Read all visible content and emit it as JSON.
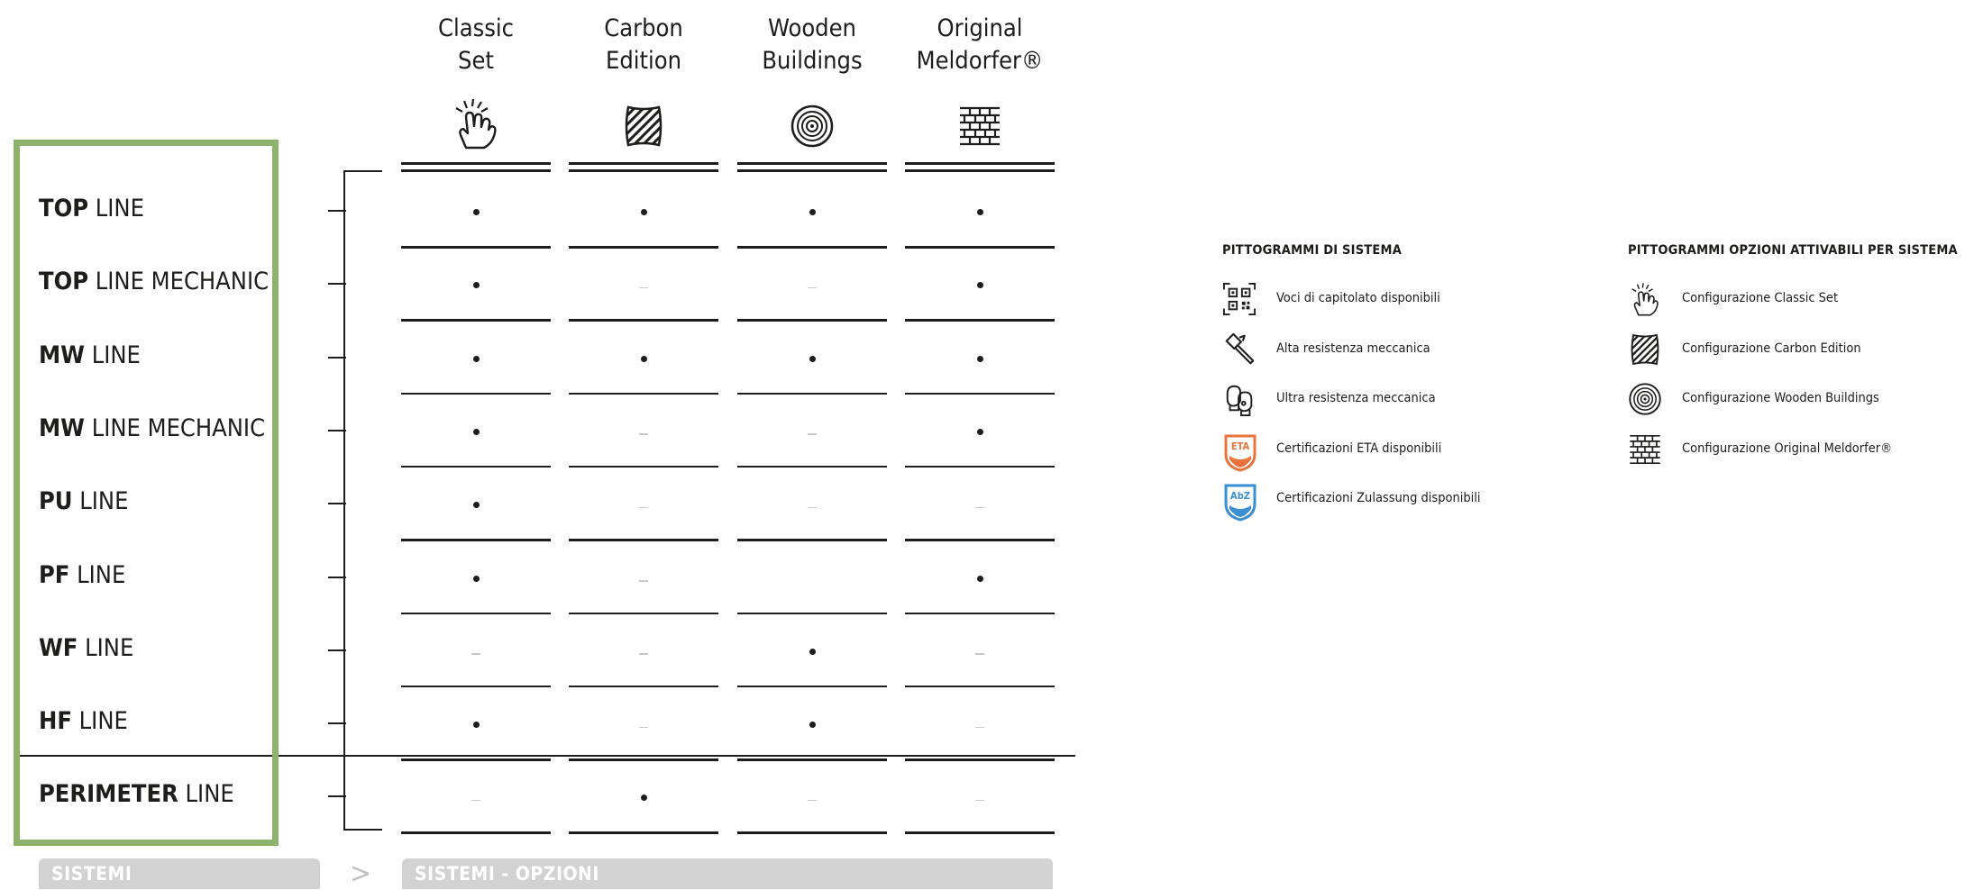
{
  "columns": [
    {
      "name": "Classic Set",
      "line1": "Classic",
      "line2": "Set",
      "icon": "hand-icon"
    },
    {
      "name": "Carbon Edition",
      "line1": "Carbon",
      "line2": "Edition",
      "icon": "carbon-stripes-icon"
    },
    {
      "name": "Wooden Buildings",
      "line1": "Wooden",
      "line2": "Buildings",
      "icon": "wood-rings-icon"
    },
    {
      "name": "Original Meldorfer",
      "line1": "Original",
      "line2": "Meldorfer®",
      "icon": "brick-wall-icon"
    }
  ],
  "rows": [
    {
      "bold": "TOP",
      "rest": " LINE",
      "values": [
        "dot",
        "dot",
        "dot",
        "dot"
      ]
    },
    {
      "bold": "TOP",
      "rest": " LINE MECHANIC",
      "values": [
        "dot",
        "dash",
        "dash",
        "dot"
      ]
    },
    {
      "bold": "MW",
      "rest": " LINE",
      "values": [
        "dot",
        "dot",
        "dot",
        "dot"
      ]
    },
    {
      "bold": "MW",
      "rest": " LINE MECHANIC",
      "values": [
        "dot",
        "dash",
        "dash",
        "dot"
      ]
    },
    {
      "bold": "PU",
      "rest": " LINE",
      "values": [
        "dot",
        "dash",
        "dash",
        "dash"
      ]
    },
    {
      "bold": "PF",
      "rest": " LINE",
      "values": [
        "dot",
        "dash",
        "",
        "dot"
      ]
    },
    {
      "bold": "WF",
      "rest": " LINE",
      "values": [
        "dash",
        "dash",
        "dot",
        "dash"
      ]
    },
    {
      "bold": "HF",
      "rest": " LINE",
      "values": [
        "dot",
        "dash",
        "dot",
        "dash"
      ]
    },
    {
      "bold": "PERIMETER",
      "rest": " LINE",
      "values": [
        "dash",
        "dot",
        "dash",
        "dash"
      ]
    }
  ],
  "footer": {
    "left": "SISTEMI",
    "arrow": ">",
    "right": "SISTEMI - OPZIONI"
  },
  "legend_system": {
    "title": "PITTOGRAMMI DI SISTEMA",
    "items": [
      {
        "icon": "qr-code-icon",
        "text": "Voci di capitolato disponibili"
      },
      {
        "icon": "hammer-icon",
        "text": "Alta resistenza meccanica"
      },
      {
        "icon": "boxing-gloves-icon",
        "text": "Ultra resistenza meccanica"
      },
      {
        "icon": "eta-badge-icon",
        "text": "Certificazioni ETA disponibili",
        "badge": "ETA",
        "color": "#e8743b"
      },
      {
        "icon": "abz-badge-icon",
        "text": "Certificazioni Zulassung disponibili",
        "badge": "AbZ",
        "color": "#3b8fd0"
      }
    ]
  },
  "legend_options": {
    "title": "PITTOGRAMMI OPZIONI ATTIVABILI PER SISTEMA",
    "items": [
      {
        "icon": "hand-icon",
        "text": "Configurazione Classic Set"
      },
      {
        "icon": "carbon-stripes-icon",
        "text": "Configurazione Carbon Edition"
      },
      {
        "icon": "wood-rings-icon",
        "text": "Configurazione Wooden Buildings"
      },
      {
        "icon": "brick-wall-icon",
        "text": "Configurazione Original Meldorfer®"
      }
    ]
  },
  "colors": {
    "highlight_box": "#8cb26b",
    "footer_bar": "#d2d2d2",
    "text": "#1d1d1b",
    "dash": "#c9c9c9"
  }
}
